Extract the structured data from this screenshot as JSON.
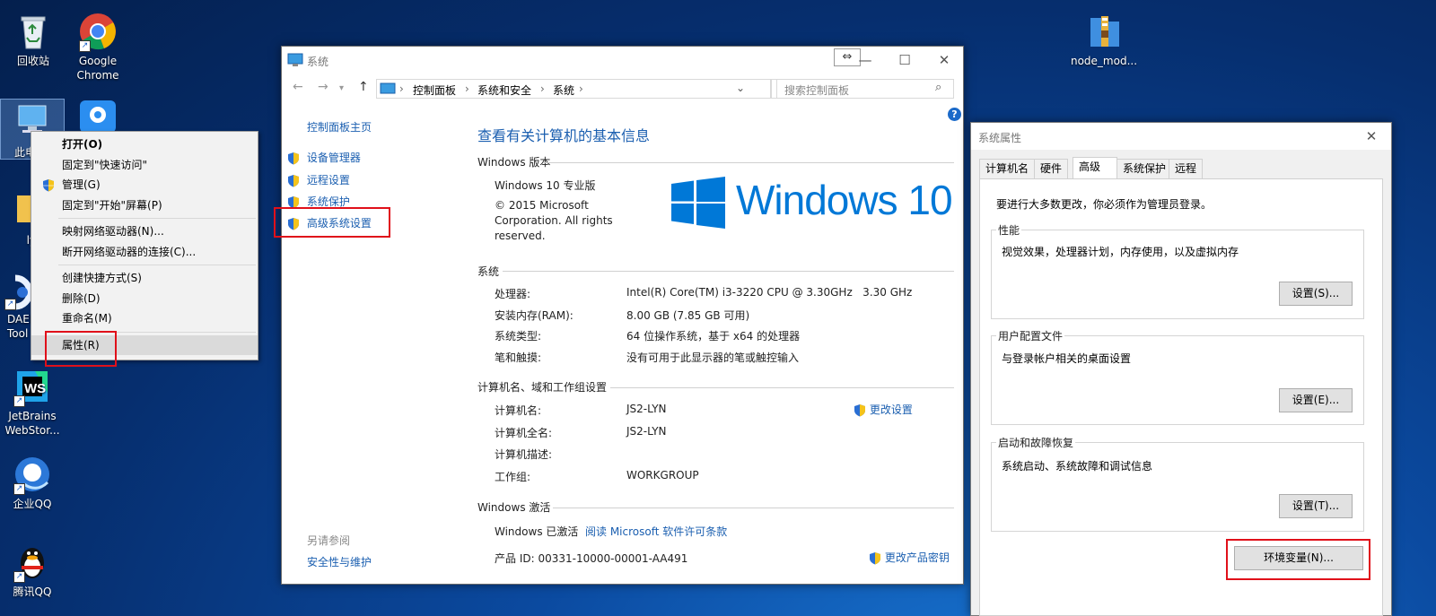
{
  "desktop": {
    "icons": {
      "recycle": "回收站",
      "chrome_line1": "Google",
      "chrome_line2": "Chrome",
      "thispc": "此电",
      "ly": "ly",
      "daemon_line1": "DAEM",
      "daemon_line2": "Tool",
      "webstorm_line1": "JetBrains",
      "webstorm_line2": "WebStor...",
      "qq_enterprise": "企业QQ",
      "qq": "腾讯QQ",
      "node": "node_mod..."
    }
  },
  "context_menu": {
    "items": [
      "打开(O)",
      "固定到\"快速访问\"",
      "管理(G)",
      "固定到\"开始\"屏幕(P)",
      "映射网络驱动器(N)...",
      "断开网络驱动器的连接(C)...",
      "创建快捷方式(S)",
      "删除(D)",
      "重命名(M)",
      "属性(R)"
    ]
  },
  "system_window": {
    "title": "系统",
    "breadcrumb": [
      "控制面板",
      "系统和安全",
      "系统"
    ],
    "search_placeholder": "搜索控制面板",
    "sidebar": {
      "home": "控制面板主页",
      "links": [
        "设备管理器",
        "远程设置",
        "系统保护",
        "高级系统设置"
      ],
      "see_also_title": "另请参阅",
      "see_also_link": "安全性与维护"
    },
    "heading": "查看有关计算机的基本信息",
    "edition_section": "Windows 版本",
    "edition": "Windows 10 专业版",
    "copyright_l1": "© 2015 Microsoft",
    "copyright_l2": "Corporation. All rights",
    "copyright_l3": "reserved.",
    "logo_text": "Windows 10",
    "system_section": "系统",
    "system_rows": [
      {
        "label": "处理器:",
        "value": "Intel(R) Core(TM) i3-3220 CPU @ 3.30GHz   3.30 GHz"
      },
      {
        "label": "安装内存(RAM):",
        "value": "8.00 GB (7.85 GB 可用)"
      },
      {
        "label": "系统类型:",
        "value": "64 位操作系统，基于 x64 的处理器"
      },
      {
        "label": "笔和触摸:",
        "value": "没有可用于此显示器的笔或触控输入"
      }
    ],
    "computer_section": "计算机名、域和工作组设置",
    "computer_rows": [
      {
        "label": "计算机名:",
        "value": "JS2-LYN"
      },
      {
        "label": "计算机全名:",
        "value": "JS2-LYN"
      },
      {
        "label": "计算机描述:",
        "value": ""
      },
      {
        "label": "工作组:",
        "value": "WORKGROUP"
      }
    ],
    "change_settings": "更改设置",
    "activation_section": "Windows 激活",
    "activated_text": "Windows 已激活",
    "license_link": "阅读 Microsoft 软件许可条款",
    "product_id": "产品 ID: 00331-10000-00001-AA491",
    "change_key": "更改产品密钥",
    "help": "?"
  },
  "sysprops": {
    "title": "系统属性",
    "tabs": [
      "计算机名",
      "硬件",
      "高级",
      "系统保护",
      "远程"
    ],
    "admin_note": "要进行大多数更改，你必须作为管理员登录。",
    "perf_title": "性能",
    "perf_desc": "视觉效果，处理器计划，内存使用，以及虚拟内存",
    "perf_btn": "设置(S)...",
    "profile_title": "用户配置文件",
    "profile_desc": "与登录帐户相关的桌面设置",
    "profile_btn": "设置(E)...",
    "startup_title": "启动和故障恢复",
    "startup_desc": "系统启动、系统故障和调试信息",
    "startup_btn": "设置(T)...",
    "env_btn": "环境变量(N)..."
  },
  "colors": {
    "link": "#1b5fb0",
    "highlight_red": "#e0101a",
    "win_blue": "#0078d7"
  }
}
